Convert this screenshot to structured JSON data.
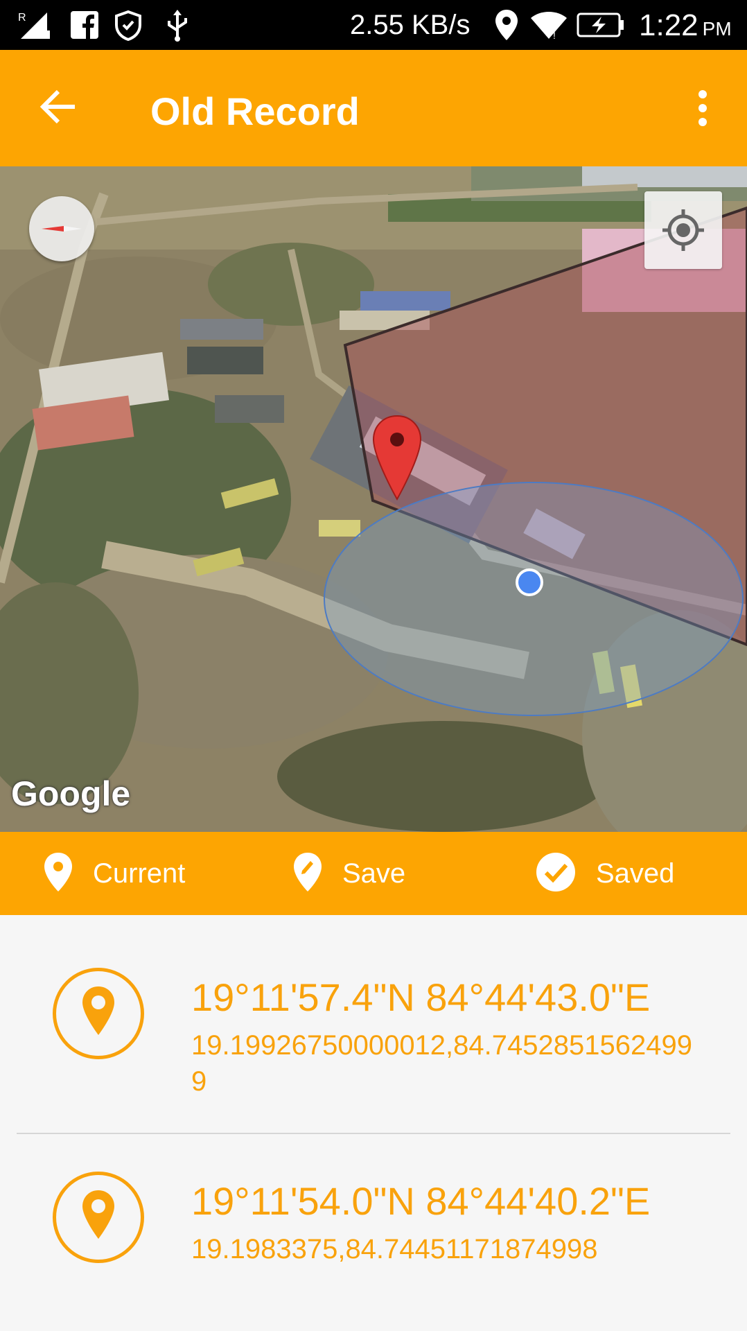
{
  "status_bar": {
    "network_speed": "2.55 KB/s",
    "time": "1:22",
    "ampm": "PM",
    "icons": [
      "signal-icon",
      "facebook-icon",
      "shield-icon",
      "usb-icon",
      "location-icon",
      "wifi-icon",
      "battery-charging-icon"
    ]
  },
  "app_bar": {
    "title": "Old Record",
    "back_icon": "back-arrow-icon",
    "menu_icon": "more-vert-icon"
  },
  "map": {
    "attribution": "Google",
    "compass_icon": "compass-icon",
    "my_location_icon": "my-location-icon"
  },
  "actions": [
    {
      "label": "Current",
      "icon": "location-pin-icon"
    },
    {
      "label": "Save",
      "icon": "edit-pin-icon"
    },
    {
      "label": "Saved",
      "icon": "check-circle-icon"
    }
  ],
  "records": [
    {
      "dms": "19°11'57.4\"N 84°44'43.0\"E",
      "decimal": "19.19926750000012,84.74528515624999"
    },
    {
      "dms": "19°11'54.0\"N 84°44'40.2\"E",
      "decimal": "19.1983375,84.74451171874998"
    }
  ],
  "colors": {
    "accent": "#fda502",
    "status_bar": "#000000",
    "text_accent": "#f9a20c",
    "background": "#f6f6f6"
  }
}
